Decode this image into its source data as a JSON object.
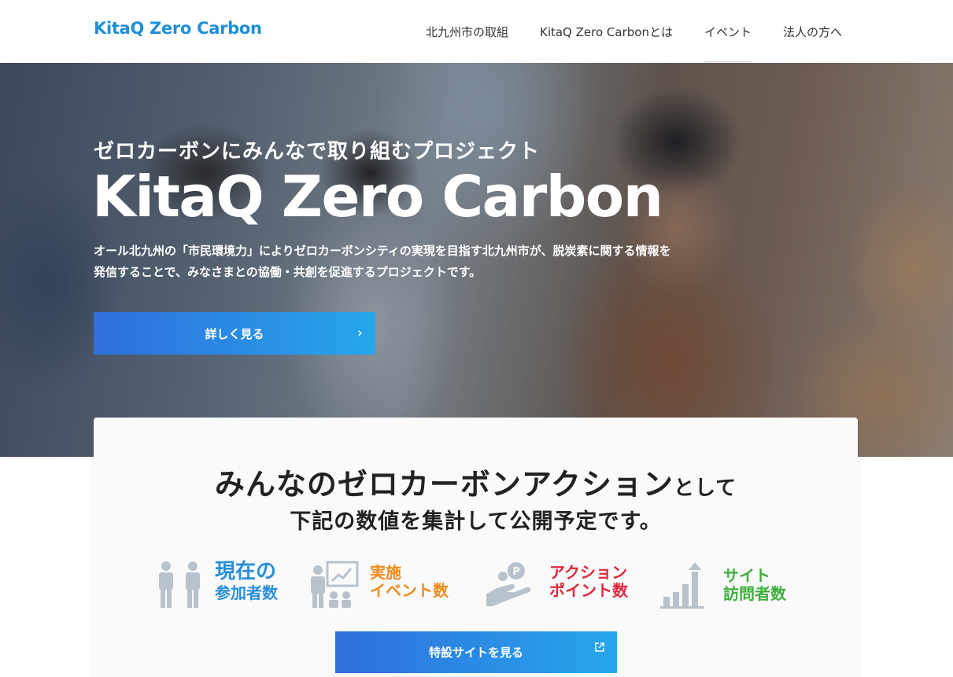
{
  "header": {
    "logo": "KitaQ Zero Carbon",
    "nav": [
      {
        "label": "北九州市の取組"
      },
      {
        "label": "KitaQ Zero Carbonとは"
      },
      {
        "label": "イベント"
      },
      {
        "label": "法人の方へ"
      }
    ]
  },
  "hero": {
    "subtitle": "ゼロカーボンにみんなで取り組むプロジェクト",
    "title": "KitaQ Zero Carbon",
    "description_line1": "オール北九州の「市民環境力」によりゼロカーボンシティの実現を目指す北九州市が、脱炭素に関する情報を",
    "description_line2": "発信することで、みなさまとの協働・共創を促進するプロジェクトです。",
    "button_label": "詳しく見る",
    "button_icon": "chevron-right-icon"
  },
  "card": {
    "heading_main": "みんなのゼロカーボンアクション",
    "heading_suffix": "として",
    "heading_line2": "下記の数値を集計して公開予定です。",
    "stats": [
      {
        "line1": "現在の",
        "line2": "参加者数",
        "color": "#2a8fd8",
        "icon": "people-icon"
      },
      {
        "line1": "実施",
        "line2": "イベント数",
        "color": "#f08a1c",
        "icon": "presentation-icon"
      },
      {
        "line1": "アクション",
        "line2": "ポイント数",
        "color": "#e0283c",
        "icon": "hand-coin-icon"
      },
      {
        "line1": "サイト",
        "line2": "訪問者数",
        "color": "#3fae3c",
        "icon": "growth-chart-icon"
      }
    ],
    "button_label": "特設サイトを見る",
    "button_icon": "external-link-icon"
  },
  "colors": {
    "brand_blue": "#1f8fd6",
    "button_gradient_start": "#2f6fdc",
    "button_gradient_end": "#26a6ec",
    "icon_gray": "#b8c2cc"
  }
}
